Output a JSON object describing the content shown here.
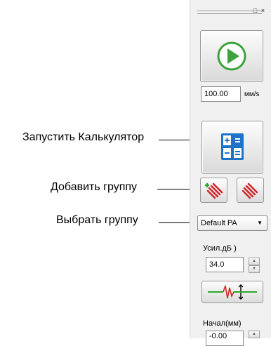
{
  "annotations": {
    "calculator": "Запустить Калькулятор",
    "add_group": "Добавить группу",
    "select_group": "Выбрать группу"
  },
  "panel": {
    "window_buttons": [
      "□",
      "×"
    ],
    "play_icon": "play-icon",
    "speed": {
      "value": "100.00",
      "unit": "мм/s"
    },
    "calculator_icon": "calculator-icon",
    "add_group_icon": "add-group-icon",
    "remove_group_icon": "group-icon",
    "group_select": {
      "selected": "Default PA",
      "arrow": "▼"
    },
    "gain": {
      "label": "Усил.дБ )",
      "value": "34.0"
    },
    "gate_icon": "gate-icon",
    "start": {
      "label": "Начал(мм)",
      "value": "-0.00"
    },
    "spin_up": "▲",
    "spin_down": "▼"
  },
  "colors": {
    "play_green": "#3ca33c",
    "calc_blue": "#1e73c8",
    "group_red": "#d0262a",
    "add_green": "#2aa82a"
  }
}
